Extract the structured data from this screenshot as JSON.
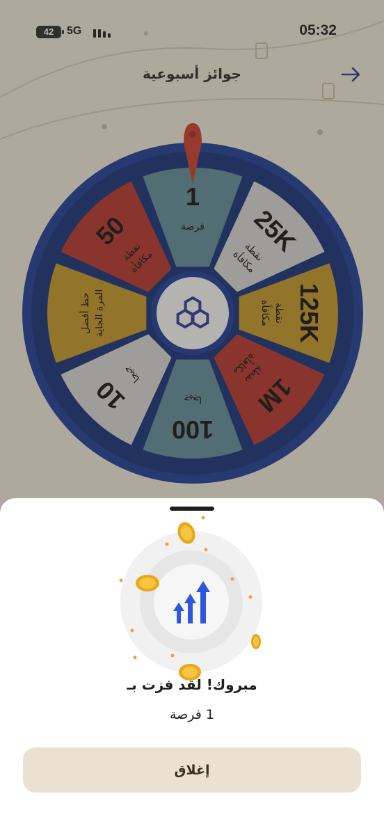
{
  "status_bar": {
    "battery": "42",
    "network": "5G",
    "time": "05:32"
  },
  "header": {
    "title": "جوائز أسبوعية",
    "back_icon": "arrow-right-icon"
  },
  "wheel": {
    "logo_icon": "hexagon-logo-icon",
    "pointer_icon": "map-pin-pointer-icon",
    "colors": {
      "rim": "#1a3a9c",
      "teal": "#5f8ea0",
      "light": "#dcdcdc",
      "gold": "#c99a2a",
      "red": "#b8352e"
    },
    "segments": [
      {
        "big": "1",
        "small1": "فرصة",
        "small2": "",
        "color": "#5f8ea0"
      },
      {
        "big": "25K",
        "small1": "نقطة",
        "small2": "مكافأة",
        "color": "#dcdcdc"
      },
      {
        "big": "125K",
        "small1": "نقطة",
        "small2": "مكافأة",
        "color": "#c99a2a"
      },
      {
        "big": "1M",
        "small1": "نقطة",
        "small2": "مكافأة",
        "color": "#b8352e"
      },
      {
        "big": "100",
        "small1": "جيجا",
        "small2": "",
        "color": "#5f8ea0"
      },
      {
        "big": "10",
        "small1": "جيجا",
        "small2": "",
        "color": "#dcdcdc"
      },
      {
        "big": "",
        "small1": "حظ أفضل",
        "small2": "المرة الجاية",
        "color": "#c99a2a"
      },
      {
        "big": "50",
        "small1": "نقطة",
        "small2": "مكافأة",
        "color": "#b8352e"
      }
    ]
  },
  "result_sheet": {
    "illustration_icon": "growth-arrows-coins-icon",
    "title": "مبروك! لقد فزت بـ",
    "prize": "1 فرصة",
    "close_label": "إغلاق"
  }
}
